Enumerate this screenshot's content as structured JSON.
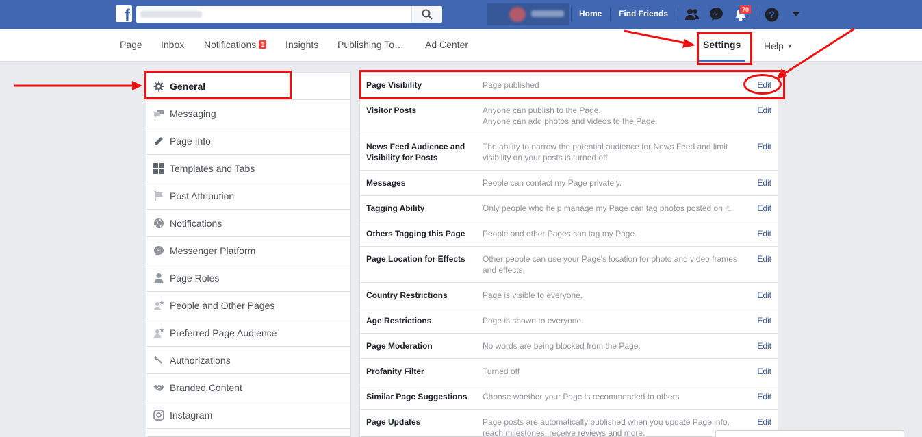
{
  "topbar": {
    "logo_letter": "f",
    "home": "Home",
    "find_friends": "Find Friends",
    "notif_count": "70",
    "icons": [
      "friends-icon",
      "messenger-icon",
      "bell-icon",
      "help-icon",
      "dropdown-caret-icon"
    ]
  },
  "pagenav": {
    "items": [
      "Page",
      "Inbox",
      "Notifications",
      "Insights",
      "Publishing To…",
      "Ad Center"
    ],
    "notif_badge": "1",
    "settings": "Settings",
    "help": "Help"
  },
  "sidebar": {
    "items": [
      {
        "label": "General",
        "icon": "gear-icon"
      },
      {
        "label": "Messaging",
        "icon": "chat-icon"
      },
      {
        "label": "Page Info",
        "icon": "pencil-icon"
      },
      {
        "label": "Templates and Tabs",
        "icon": "grid-icon"
      },
      {
        "label": "Post Attribution",
        "icon": "flag-icon"
      },
      {
        "label": "Notifications",
        "icon": "globe-icon"
      },
      {
        "label": "Messenger Platform",
        "icon": "messenger-icon"
      },
      {
        "label": "Page Roles",
        "icon": "person-icon"
      },
      {
        "label": "People and Other Pages",
        "icon": "person-star-icon"
      },
      {
        "label": "Preferred Page Audience",
        "icon": "person-star-icon"
      },
      {
        "label": "Authorizations",
        "icon": "wrench-icon"
      },
      {
        "label": "Branded Content",
        "icon": "handshake-icon"
      },
      {
        "label": "Instagram",
        "icon": "instagram-icon"
      }
    ]
  },
  "settings_rows": [
    {
      "label": "Page Visibility",
      "desc": "Page published",
      "edit": "Edit"
    },
    {
      "label": "Visitor Posts",
      "desc": "Anyone can publish to the Page.\nAnyone can add photos and videos to the Page.",
      "edit": "Edit"
    },
    {
      "label": "News Feed Audience and Visibility for Posts",
      "desc": "The ability to narrow the potential audience for News Feed and limit visibility on your posts is turned off",
      "edit": "Edit"
    },
    {
      "label": "Messages",
      "desc": "People can contact my Page privately.",
      "edit": "Edit"
    },
    {
      "label": "Tagging Ability",
      "desc": "Only people who help manage my Page can tag photos posted on it.",
      "edit": "Edit"
    },
    {
      "label": "Others Tagging this Page",
      "desc": "People and other Pages can tag my Page.",
      "edit": "Edit"
    },
    {
      "label": "Page Location for Effects",
      "desc": "Other people can use your Page's location for photo and video frames and effects.",
      "edit": "Edit"
    },
    {
      "label": "Country Restrictions",
      "desc": "Page is visible to everyone.",
      "edit": "Edit"
    },
    {
      "label": "Age Restrictions",
      "desc": "Page is shown to everyone.",
      "edit": "Edit"
    },
    {
      "label": "Page Moderation",
      "desc": "No words are being blocked from the Page.",
      "edit": "Edit"
    },
    {
      "label": "Profanity Filter",
      "desc": "Turned off",
      "edit": "Edit"
    },
    {
      "label": "Similar Page Suggestions",
      "desc": "Choose whether your Page is recommended to others",
      "edit": "Edit"
    },
    {
      "label": "Page Updates",
      "desc": "Page posts are automatically published when you update Page info, reach milestones, receive reviews and more.",
      "edit": "Edit"
    }
  ],
  "colors": {
    "brand": "#4267b2",
    "link": "#365899",
    "annotation": "#ee1111"
  }
}
